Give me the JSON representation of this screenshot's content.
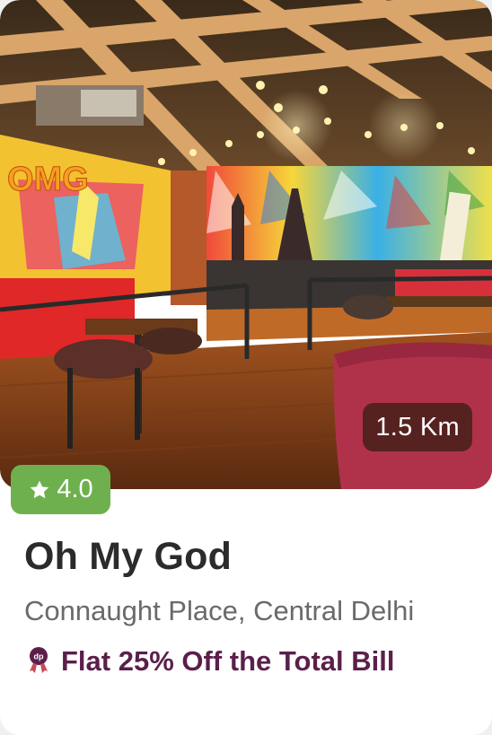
{
  "restaurant": {
    "name": "Oh My God",
    "location": "Connaught Place, Central Delhi",
    "rating": "4.0",
    "distance": "1.5 Km",
    "offer": "Flat 25% Off the Total Bill",
    "image_sign_text": "OMG"
  },
  "icons": {
    "rating": "star-icon",
    "offer": "dineout-dp-icon"
  },
  "colors": {
    "rating_badge": "#6fb04e",
    "offer_text": "#5b1f4a",
    "title_text": "#2b2b2b",
    "location_text": "#6a6a6a"
  }
}
